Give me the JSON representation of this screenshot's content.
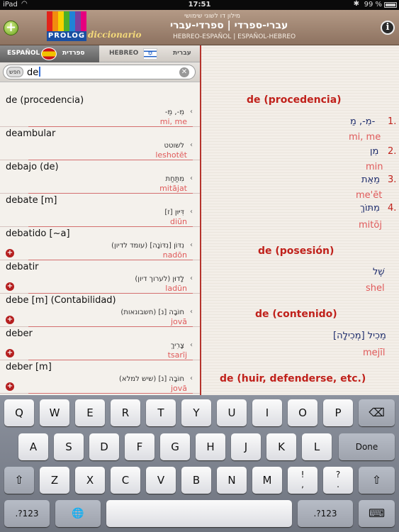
{
  "status_bar": {
    "device": "iPad",
    "time": "17:51",
    "battery": "99 %"
  },
  "header": {
    "logo_text": "PROLOG",
    "logo_sub": "diccionario",
    "line1": "מילון דו לשוני שימושי",
    "line2": "עברי-ספרדי | ספרדי-עברי",
    "line3": "HEBREO-ESPAÑOL | ESPAÑOL-HEBREO",
    "add_symbol": "+",
    "info_symbol": "i",
    "logo_colors": [
      "#e2231a",
      "#f28c0f",
      "#f7d300",
      "#4caf2a",
      "#1f84d6",
      "#7b3fa0",
      "#e6007e"
    ]
  },
  "lang_tabs": {
    "es_label": "ESPAÑOL",
    "es_hebrew": "ספרדית",
    "he_label": "HEBREO",
    "he_hebrew": "עברית"
  },
  "search": {
    "button": "חפש",
    "value": "de",
    "clear": "✕"
  },
  "results": [
    {
      "es": "de (procedencia)",
      "heb": "מִ-, מֵ-",
      "translit": "mi, me",
      "plus": false
    },
    {
      "es": "deambular",
      "heb": "לשוטט",
      "translit": "leshotēt",
      "plus": false
    },
    {
      "es": "debajo (de)",
      "heb": "מִתַּחַת",
      "translit": "mitājat",
      "plus": false
    },
    {
      "es": "debate [m]",
      "heb": "דִּיּוּן [ז]",
      "translit": "diūn",
      "plus": false
    },
    {
      "es": "debatido [~a]",
      "heb": "נִדּוֹן [נִדּוֹנָה] (עומד לדיון)",
      "translit": "nadōn",
      "plus": true
    },
    {
      "es": "debatir",
      "heb": "לָדוּן (לערוך דיון)",
      "translit": "ladūn",
      "plus": true
    },
    {
      "es": "debe [m] (Contabilidad)",
      "heb": "חוֹבָה [נ] (חשבונאות)",
      "translit": "jovā",
      "plus": true
    },
    {
      "es": "deber",
      "heb": "צָרִיךְ",
      "translit": "tsarīj",
      "plus": true
    },
    {
      "es": "deber [m]",
      "heb": "חוֹבָה [נ] (שיש למלא)",
      "translit": "jovā",
      "plus": true
    }
  ],
  "detail": {
    "head1": "de (procedencia)",
    "n1": "1.",
    "h1": "מִ-, מֵ-",
    "t1": "mi, me",
    "n2": "2.",
    "h2": "מִן",
    "t2": "min",
    "n3": "3.",
    "h3": "מֵאֵת",
    "t3": "me'ēt",
    "n4": "4.",
    "h4": "מִתּוֹךְ",
    "t4": "mitōj",
    "head2": "de (posesión)",
    "h5": "שֶׁל",
    "t5": "shel",
    "head3": "de (contenido)",
    "h6": "מֵכִיל [מְכִילָה]",
    "t6": "mejīl",
    "head4": "de (huir, defenderse, etc.)"
  },
  "keyboard": {
    "row1": [
      "Q",
      "W",
      "E",
      "R",
      "T",
      "Y",
      "U",
      "I",
      "O",
      "P"
    ],
    "row2": [
      "A",
      "S",
      "D",
      "F",
      "G",
      "H",
      "J",
      "K",
      "L"
    ],
    "row3": [
      "Z",
      "X",
      "C",
      "V",
      "B",
      "N",
      "M"
    ],
    "backspace": "⌫",
    "done": "Done",
    "shift": "⇧",
    "excl_top": "!",
    "excl_bot": ",",
    "q_top": "?",
    "q_bot": ".",
    "num": ".?123",
    "globe": "🌐",
    "hide": "⌨"
  }
}
